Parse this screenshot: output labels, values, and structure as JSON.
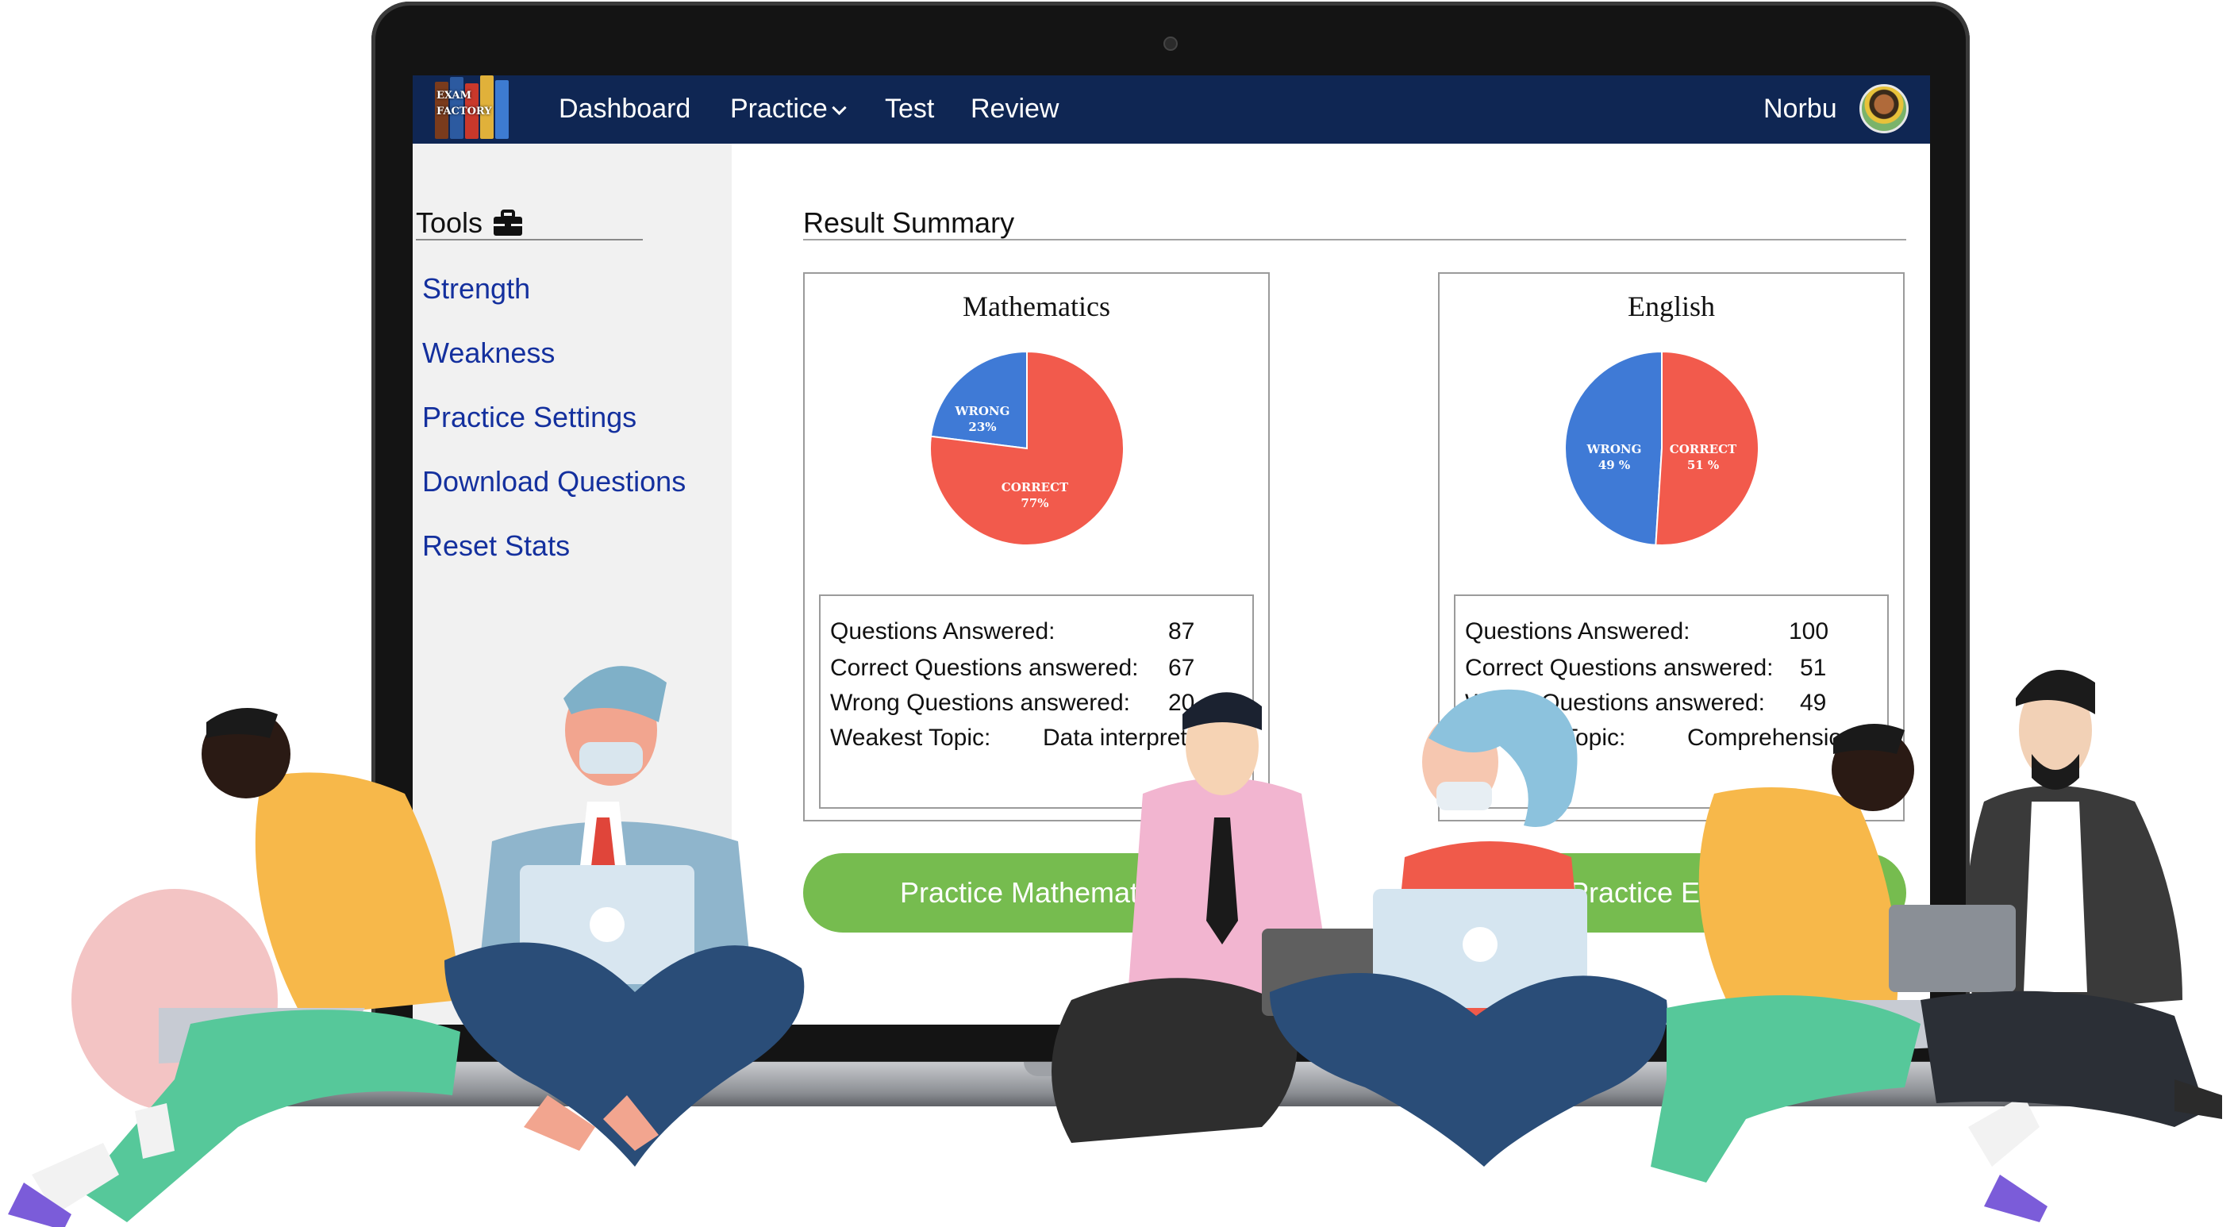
{
  "app": {
    "logo_text": "EXAM\nFACTORY"
  },
  "navbar": {
    "items": [
      {
        "label": "Dashboard"
      },
      {
        "label": "Practice",
        "has_dropdown": true
      },
      {
        "label": "Test"
      },
      {
        "label": "Review"
      }
    ],
    "user_name": "Norbu"
  },
  "sidebar": {
    "title": "Tools",
    "title_icon": "toolbox-icon",
    "links": [
      {
        "label": "Strength"
      },
      {
        "label": "Weakness"
      },
      {
        "label": "Practice Settings"
      },
      {
        "label": "Download Questions"
      },
      {
        "label": "Reset Stats"
      }
    ]
  },
  "main": {
    "title": "Result Summary",
    "subjects": [
      {
        "name": "Mathematics",
        "button_label": "Practice Mathematics",
        "chart_data": {
          "type": "pie",
          "labels": [
            "WRONG",
            "CORRECT"
          ],
          "percent_text": [
            "23%",
            "77%"
          ],
          "values": [
            23,
            77
          ],
          "colors": [
            "#3f7ad6",
            "#f25a4c"
          ]
        },
        "stats": [
          {
            "label": "Questions Answered:",
            "value": "87"
          },
          {
            "label": "Correct Questions answered:",
            "value": "67"
          },
          {
            "label": "Wrong Questions answered:",
            "value": "20"
          },
          {
            "label": "Weakest Topic:",
            "value": "Data interpretation"
          }
        ]
      },
      {
        "name": "English",
        "button_label": "Practice English",
        "chart_data": {
          "type": "pie",
          "labels": [
            "WRONG",
            "CORRECT"
          ],
          "percent_text": [
            "49 %",
            "51 %"
          ],
          "values": [
            49,
            51
          ],
          "colors": [
            "#3f7ad6",
            "#f25a4c"
          ]
        },
        "stats": [
          {
            "label": "Questions Answered:",
            "value": "100"
          },
          {
            "label": "Correct Questions answered:",
            "value": "51"
          },
          {
            "label": "Wrong Questions answered:",
            "value": "49"
          },
          {
            "label": "Weakest Topic:",
            "value": "Comprehension"
          }
        ]
      }
    ]
  },
  "colors": {
    "navbar": "#0f2653",
    "sidebar_bg": "#f1f1f1",
    "link": "#14309e",
    "button": "#76bc4f",
    "pie_wrong": "#3f7ad6",
    "pie_correct": "#f25a4c"
  }
}
